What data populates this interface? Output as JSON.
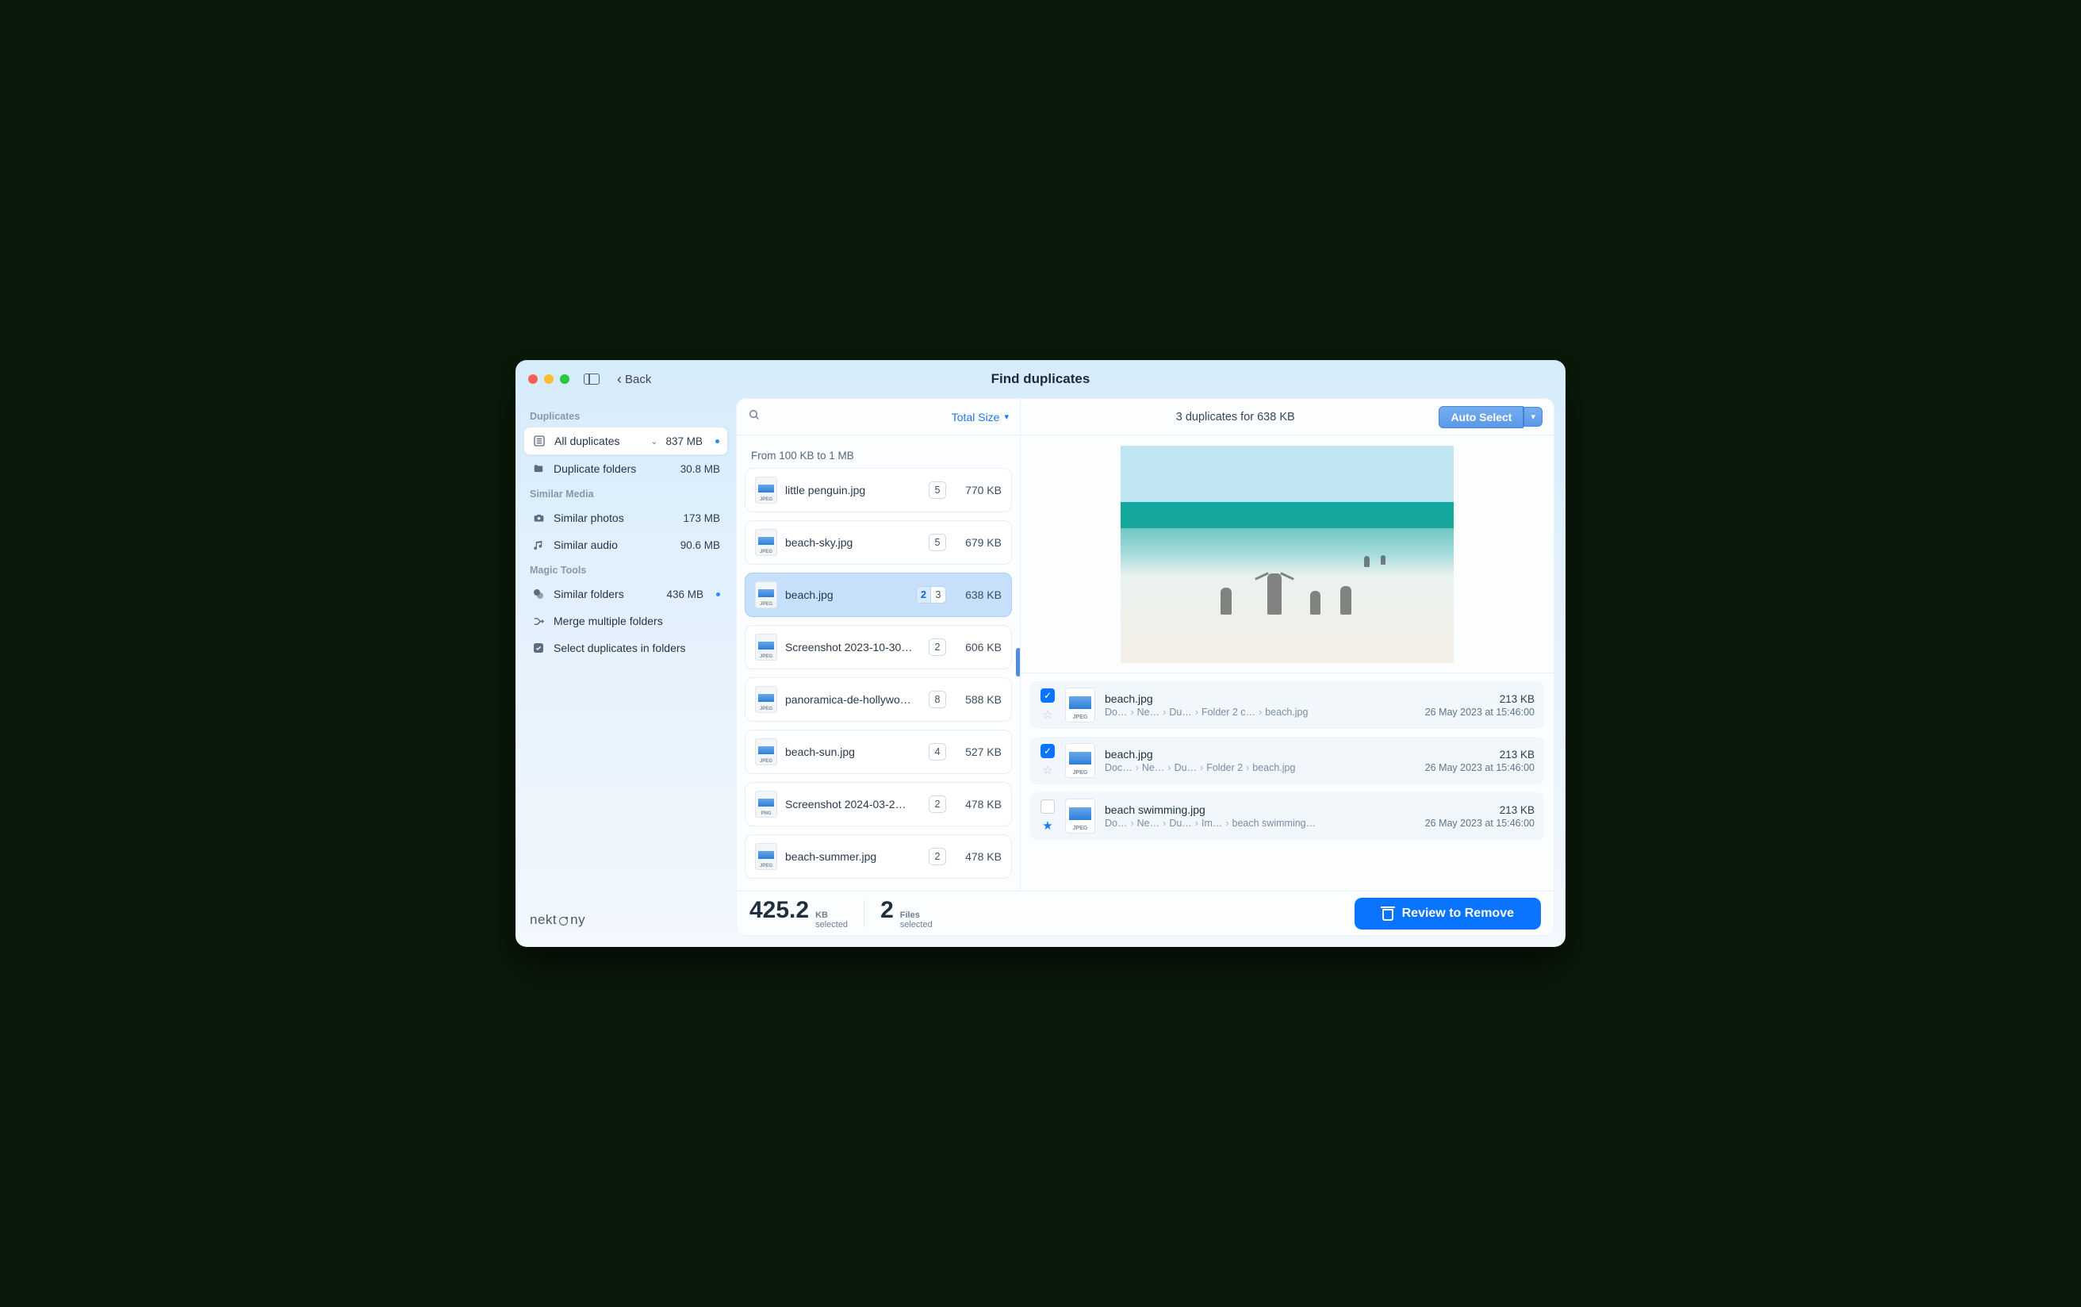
{
  "titlebar": {
    "back": "Back",
    "title": "Find duplicates"
  },
  "sidebar": {
    "sections": [
      {
        "label": "Duplicates",
        "items": [
          {
            "icon": "list",
            "label": "All duplicates",
            "chevron": true,
            "size": "837 MB",
            "dot": true,
            "active": true
          },
          {
            "icon": "folder",
            "label": "Duplicate folders",
            "size": "30.8 MB"
          }
        ]
      },
      {
        "label": "Similar Media",
        "items": [
          {
            "icon": "camera",
            "label": "Similar photos",
            "size": "173 MB"
          },
          {
            "icon": "music",
            "label": "Similar audio",
            "size": "90.6 MB"
          }
        ]
      },
      {
        "label": "Magic Tools",
        "items": [
          {
            "icon": "similar",
            "label": "Similar folders",
            "size": "436 MB",
            "dot": true
          },
          {
            "icon": "merge",
            "label": "Merge multiple folders"
          },
          {
            "icon": "check",
            "label": "Select duplicates in folders"
          }
        ]
      }
    ],
    "brand": "nektony"
  },
  "toolbar": {
    "sort_label": "Total Size",
    "summary": "3 duplicates for 638 KB",
    "auto_select": "Auto Select"
  },
  "group_header": "From 100 KB to 1 MB",
  "files": [
    {
      "name": "little penguin.jpg",
      "ext": "JPEG",
      "count": "5",
      "size": "770 KB"
    },
    {
      "name": "beach-sky.jpg",
      "ext": "JPEG",
      "count": "5",
      "size": "679 KB"
    },
    {
      "name": "beach.jpg",
      "ext": "JPEG",
      "count_sel": "2",
      "count_tot": "3",
      "size": "638 KB",
      "selected": true
    },
    {
      "name": "Screenshot 2023-10-30…",
      "ext": "JPEG",
      "count": "2",
      "size": "606 KB"
    },
    {
      "name": "panoramica-de-hollywo…",
      "ext": "JPEG",
      "count": "8",
      "size": "588 KB"
    },
    {
      "name": "beach-sun.jpg",
      "ext": "JPEG",
      "count": "4",
      "size": "527 KB"
    },
    {
      "name": "Screenshot 2024-03-2…",
      "ext": "PNG",
      "count": "2",
      "size": "478 KB"
    },
    {
      "name": "beach-summer.jpg",
      "ext": "JPEG",
      "count": "2",
      "size": "478 KB"
    }
  ],
  "duplicates": [
    {
      "checked": true,
      "starred": false,
      "name": "beach.jpg",
      "path": [
        "Do…",
        "Ne…",
        "Du…",
        "Folder 2 c…",
        "beach.jpg"
      ],
      "size": "213 KB",
      "date": "26 May 2023 at 15:46:00"
    },
    {
      "checked": true,
      "starred": false,
      "name": "beach.jpg",
      "path": [
        "Doc…",
        "Ne…",
        "Du…",
        "Folder 2",
        "beach.jpg"
      ],
      "size": "213 KB",
      "date": "26 May 2023 at 15:46:00"
    },
    {
      "checked": false,
      "starred": true,
      "name": "beach swimming.jpg",
      "path": [
        "Do…",
        "Ne…",
        "Du…",
        "Im…",
        "beach swimming…"
      ],
      "size": "213 KB",
      "date": "26 May 2023 at 15:46:00"
    }
  ],
  "footer": {
    "size_val": "425.2",
    "size_unit": "KB",
    "size_sub": "selected",
    "files_val": "2",
    "files_unit": "Files",
    "files_sub": "selected",
    "review": "Review to Remove"
  }
}
